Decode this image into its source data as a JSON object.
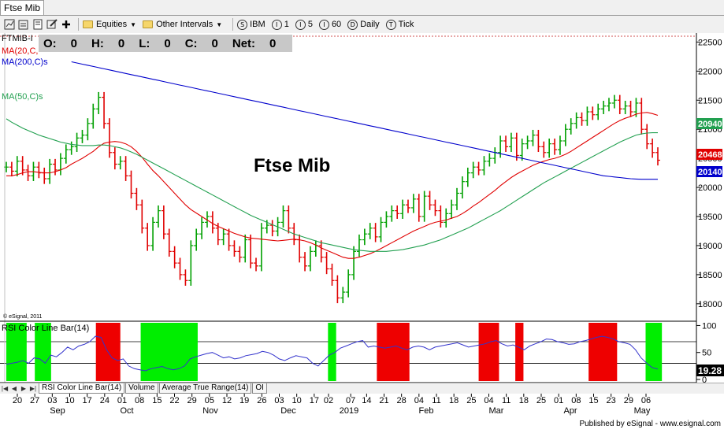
{
  "window": {
    "title": "Ftse Mib"
  },
  "toolbar": {
    "items": [
      {
        "label": "Equities",
        "icon": "folder-icon",
        "dropdown": true
      },
      {
        "label": "Other Intervals",
        "icon": "folder-icon",
        "dropdown": true
      },
      {
        "label": "IBM",
        "icon": "interval-S"
      },
      {
        "label": "1",
        "icon": "interval-I"
      },
      {
        "label": "5",
        "icon": "interval-I"
      },
      {
        "label": "60",
        "icon": "interval-I"
      },
      {
        "label": "Daily",
        "icon": "interval-D"
      },
      {
        "label": "Tick",
        "icon": "interval-T"
      }
    ],
    "circle_letters": [
      "S",
      "I",
      "I",
      "I",
      "D",
      "T"
    ]
  },
  "ohlc": {
    "o_label": "O:",
    "o": "0",
    "h_label": "H:",
    "h": "0",
    "l_label": "L:",
    "l": "0",
    "c_label": "C:",
    "c": "0",
    "net_label": "Net:",
    "net": "0"
  },
  "legend": {
    "symbol": "FTMIB-I",
    "ma20": "MA(20,C,",
    "ma200": "MA(200,C)s",
    "ma50": "MA(50,C)s",
    "watermark": "© eSignal, 2011"
  },
  "chart_title": "Ftse Mib",
  "price_badges": {
    "ma50": "20940",
    "last": "20468",
    "ma200": "20140"
  },
  "rsi_badge": "19.28",
  "rsi_label": "RSI Color Line Bar(14)",
  "tabs": [
    "RSI Color Line Bar(14)",
    "Volume",
    "Average True Range(14)",
    "OI"
  ],
  "footer": "Published by eSignal - www.esignal.com",
  "colors": {
    "up_bar": "#00a000",
    "down_bar": "#e00000",
    "ma20": "#e00000",
    "ma50": "#22a050",
    "ma200": "#0000cc",
    "rsi_line": "#3333cc",
    "rsi_green": "#00ee00",
    "rsi_red": "#ee0000"
  },
  "chart_data": {
    "type": "bar",
    "price_axis": {
      "ticks": [
        18000,
        18500,
        19000,
        19500,
        20000,
        20500,
        21000,
        21500,
        22000,
        22500
      ],
      "range": [
        17700,
        22600
      ]
    },
    "rsi_axis": {
      "ticks": [
        0,
        50,
        100
      ],
      "levels": [
        30,
        70
      ]
    },
    "date_ticks": [
      "20",
      "27",
      "03",
      "10",
      "17",
      "24",
      "01",
      "08",
      "15",
      "22",
      "29",
      "05",
      "12",
      "19",
      "26",
      "03",
      "10",
      "17",
      "02",
      "07",
      "14",
      "21",
      "28",
      "04",
      "11",
      "18",
      "25",
      "04",
      "11",
      "18",
      "25",
      "01",
      "08",
      "15",
      "23",
      "29",
      "06"
    ],
    "month_labels": [
      "Sep",
      "Oct",
      "Nov",
      "Dec",
      "2019",
      "Feb",
      "Mar",
      "Apr",
      "May"
    ],
    "closes": [
      20350,
      20280,
      20450,
      20300,
      20200,
      20350,
      20250,
      20150,
      20400,
      20300,
      20500,
      20650,
      20700,
      20850,
      20900,
      21100,
      21350,
      21550,
      21100,
      20600,
      20400,
      20450,
      20200,
      19900,
      19700,
      19300,
      19000,
      19400,
      19600,
      19200,
      18900,
      18700,
      18500,
      18400,
      19000,
      19200,
      19400,
      19500,
      19300,
      19100,
      19200,
      19000,
      18900,
      18800,
      19100,
      18700,
      18650,
      19300,
      19350,
      19250,
      19400,
      19600,
      19300,
      19100,
      18800,
      18650,
      18900,
      19000,
      18800,
      18600,
      18400,
      18100,
      18200,
      18500,
      18900,
      19100,
      19200,
      19300,
      19150,
      19400,
      19500,
      19600,
      19550,
      19700,
      19650,
      19800,
      19500,
      19850,
      19700,
      19600,
      19400,
      19550,
      19700,
      19900,
      20100,
      20250,
      20350,
      20300,
      20450,
      20500,
      20600,
      20800,
      20700,
      20850,
      20550,
      20750,
      20800,
      20900,
      20700,
      20600,
      20750,
      20650,
      20800,
      21000,
      21100,
      21200,
      21150,
      21300,
      21250,
      21350,
      21400,
      21450,
      21500,
      21350,
      21400,
      21300,
      21450,
      21000,
      20750,
      20600,
      20468
    ],
    "rsi_values": [
      28,
      30,
      32,
      35,
      30,
      40,
      38,
      30,
      45,
      42,
      50,
      60,
      55,
      62,
      65,
      70,
      80,
      78,
      55,
      40,
      35,
      38,
      25,
      20,
      18,
      16,
      20,
      22,
      24,
      20,
      18,
      20,
      25,
      38,
      42,
      45,
      48,
      50,
      45,
      40,
      42,
      38,
      40,
      44,
      46,
      48,
      52,
      50,
      45,
      38,
      35,
      40,
      44,
      42,
      40,
      30,
      25,
      35,
      45,
      50,
      58,
      62,
      66,
      70,
      72,
      60,
      62,
      60,
      58,
      60,
      62,
      58,
      55,
      60,
      62,
      60,
      55,
      60,
      62,
      64,
      66,
      68,
      64,
      60,
      62,
      64,
      66,
      70,
      72,
      66,
      62,
      64,
      60,
      55,
      62,
      66,
      70,
      75,
      74,
      70,
      68,
      65,
      66,
      70,
      72,
      75,
      78,
      80,
      78,
      75,
      70,
      68,
      65,
      55,
      40,
      30,
      22,
      19.28
    ],
    "series": [
      {
        "name": "MA(20,C,",
        "values": [
          20200,
          20200,
          20220,
          20250,
          20270,
          20270,
          20260,
          20250,
          20250,
          20270,
          20300,
          20340,
          20400,
          20450,
          20500,
          20560,
          20620,
          20700,
          20760,
          20780,
          20790,
          20780,
          20750,
          20700,
          20620,
          20520,
          20400,
          20290,
          20200,
          20100,
          20000,
          19900,
          19800,
          19700,
          19620,
          19560,
          19500,
          19440,
          19380,
          19330,
          19290,
          19250,
          19210,
          19180,
          19150,
          19130,
          19120,
          19110,
          19100,
          19090,
          19080,
          19090,
          19100,
          19110,
          19100,
          19080,
          19050,
          19010,
          18960,
          18920,
          18880,
          18840,
          18800,
          18780,
          18780,
          18800,
          18830,
          18860,
          18900,
          18950,
          19000,
          19050,
          19100,
          19150,
          19200,
          19250,
          19290,
          19330,
          19370,
          19400,
          19420,
          19440,
          19470,
          19500,
          19550,
          19610,
          19680,
          19740,
          19810,
          19880,
          19950,
          20030,
          20100,
          20170,
          20230,
          20280,
          20330,
          20380,
          20420,
          20450,
          20480,
          20500,
          20530,
          20570,
          20620,
          20680,
          20740,
          20800,
          20860,
          20920,
          20980,
          21040,
          21100,
          21150,
          21190,
          21220,
          21260,
          21280,
          21290,
          21270,
          21240
        ]
      },
      {
        "name": "MA(50,C)s",
        "values": [
          21180,
          21120,
          21070,
          21020,
          20980,
          20940,
          20900,
          20870,
          20840,
          20810,
          20780,
          20760,
          20740,
          20730,
          20720,
          20720,
          20720,
          20730,
          20730,
          20720,
          20700,
          20680,
          20650,
          20610,
          20570,
          20520,
          20470,
          20420,
          20370,
          20320,
          20270,
          20220,
          20170,
          20120,
          20070,
          20020,
          19970,
          19920,
          19870,
          19820,
          19770,
          19720,
          19670,
          19620,
          19570,
          19520,
          19480,
          19440,
          19400,
          19360,
          19320,
          19280,
          19240,
          19200,
          19170,
          19140,
          19110,
          19080,
          19050,
          19030,
          19010,
          18990,
          18970,
          18950,
          18930,
          18920,
          18910,
          18900,
          18900,
          18900,
          18900,
          18910,
          18920,
          18930,
          18950,
          18970,
          18990,
          19010,
          19040,
          19070,
          19100,
          19140,
          19180,
          19220,
          19260,
          19300,
          19350,
          19400,
          19450,
          19500,
          19550,
          19600,
          19660,
          19720,
          19780,
          19840,
          19900,
          19960,
          20020,
          20080,
          20130,
          20180,
          20230,
          20280,
          20330,
          20380,
          20430,
          20480,
          20530,
          20580,
          20630,
          20680,
          20730,
          20780,
          20820,
          20860,
          20900,
          20920,
          20935,
          20940,
          20940
        ]
      },
      {
        "name": "MA(200,C)s",
        "values": [
          22400,
          22380,
          22360,
          22340,
          22320,
          22300,
          22280,
          22260,
          22240,
          22220,
          22200,
          22180,
          22160,
          22140,
          22120,
          22100,
          22080,
          22060,
          22040,
          22020,
          22000,
          21980,
          21960,
          21940,
          21920,
          21900,
          21880,
          21860,
          21840,
          21820,
          21800,
          21780,
          21760,
          21740,
          21720,
          21700,
          21680,
          21660,
          21640,
          21620,
          21600,
          21580,
          21560,
          21540,
          21520,
          21500,
          21480,
          21460,
          21440,
          21420,
          21400,
          21380,
          21360,
          21340,
          21320,
          21300,
          21280,
          21260,
          21240,
          21220,
          21200,
          21180,
          21160,
          21140,
          21120,
          21100,
          21080,
          21060,
          21040,
          21020,
          21000,
          20980,
          20960,
          20940,
          20920,
          20900,
          20880,
          20860,
          20840,
          20820,
          20800,
          20780,
          20760,
          20740,
          20720,
          20700,
          20680,
          20660,
          20640,
          20620,
          20600,
          20580,
          20560,
          20540,
          20520,
          20500,
          20480,
          20460,
          20440,
          20420,
          20400,
          20380,
          20360,
          20340,
          20320,
          20300,
          20280,
          20260,
          20240,
          20220,
          20200,
          20190,
          20180,
          20170,
          20160,
          20150,
          20145,
          20140,
          20140,
          20140,
          20140
        ]
      }
    ],
    "rsi_zones": [
      {
        "from": 0,
        "to": 4,
        "color": "green"
      },
      {
        "from": 7,
        "to": 10,
        "color": "green"
      },
      {
        "from": 22,
        "to": 27,
        "color": "red"
      },
      {
        "from": 33,
        "to": 46,
        "color": "green"
      },
      {
        "from": 79,
        "to": 80,
        "color": "green"
      },
      {
        "from": 91,
        "to": 98,
        "color": "red"
      },
      {
        "from": 116,
        "to": 120,
        "color": "red"
      },
      {
        "from": 125,
        "to": 126,
        "color": "red"
      },
      {
        "from": 143,
        "to": 149,
        "color": "red"
      },
      {
        "from": 157,
        "to": 160,
        "color": "green"
      }
    ]
  }
}
